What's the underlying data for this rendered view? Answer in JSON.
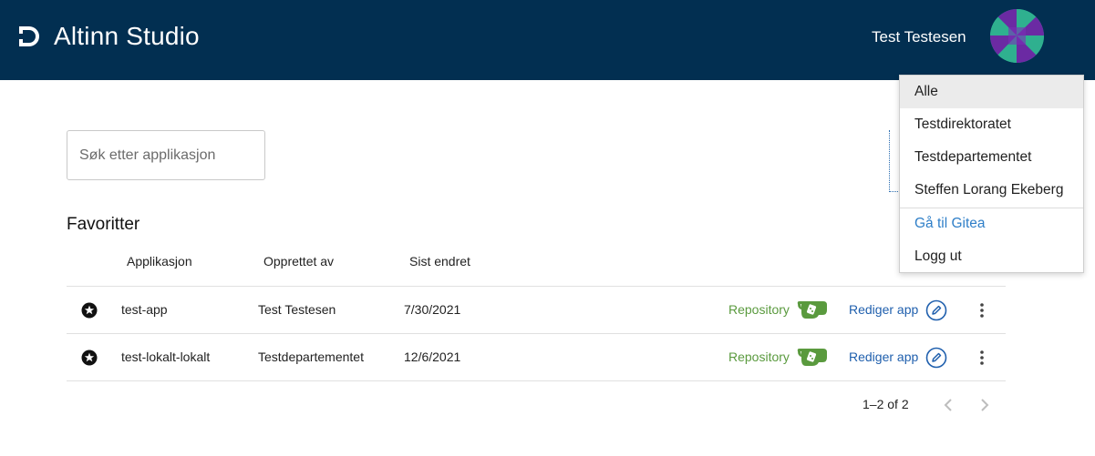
{
  "header": {
    "brand": "Altinn Studio",
    "user_name": "Test Testesen",
    "logo_icon": "altinn-logo-icon",
    "avatar_icon": "organization-avatar-icon",
    "background_color": "#022f51"
  },
  "search": {
    "placeholder": "Søk etter applikasjon",
    "value": ""
  },
  "favorites": {
    "title": "Favoritter",
    "columns": [
      "Applikasjon",
      "Opprettet av",
      "Sist endret"
    ],
    "rows": [
      {
        "name": "test-app",
        "created_by": "Test Testesen",
        "last_changed": "7/30/2021",
        "repo_label": "Repository",
        "edit_label": "Rediger app"
      },
      {
        "name": "test-lokalt-lokalt",
        "created_by": "Testdepartementet",
        "last_changed": "12/6/2021",
        "repo_label": "Repository",
        "edit_label": "Rediger app"
      }
    ],
    "pagination": {
      "range": "1–2 of 2"
    }
  },
  "menu": {
    "items": [
      "Alle",
      "Testdirektoratet",
      "Testdepartementet",
      "Steffen Lorang Ekeberg"
    ],
    "selected": "Alle",
    "gitea_link": "Gå til Gitea",
    "logout": "Logg ut"
  },
  "colors": {
    "repository_green": "#5a9a3e",
    "edit_blue": "#1f5fad",
    "menu_link_blue": "#2f7fc8"
  }
}
